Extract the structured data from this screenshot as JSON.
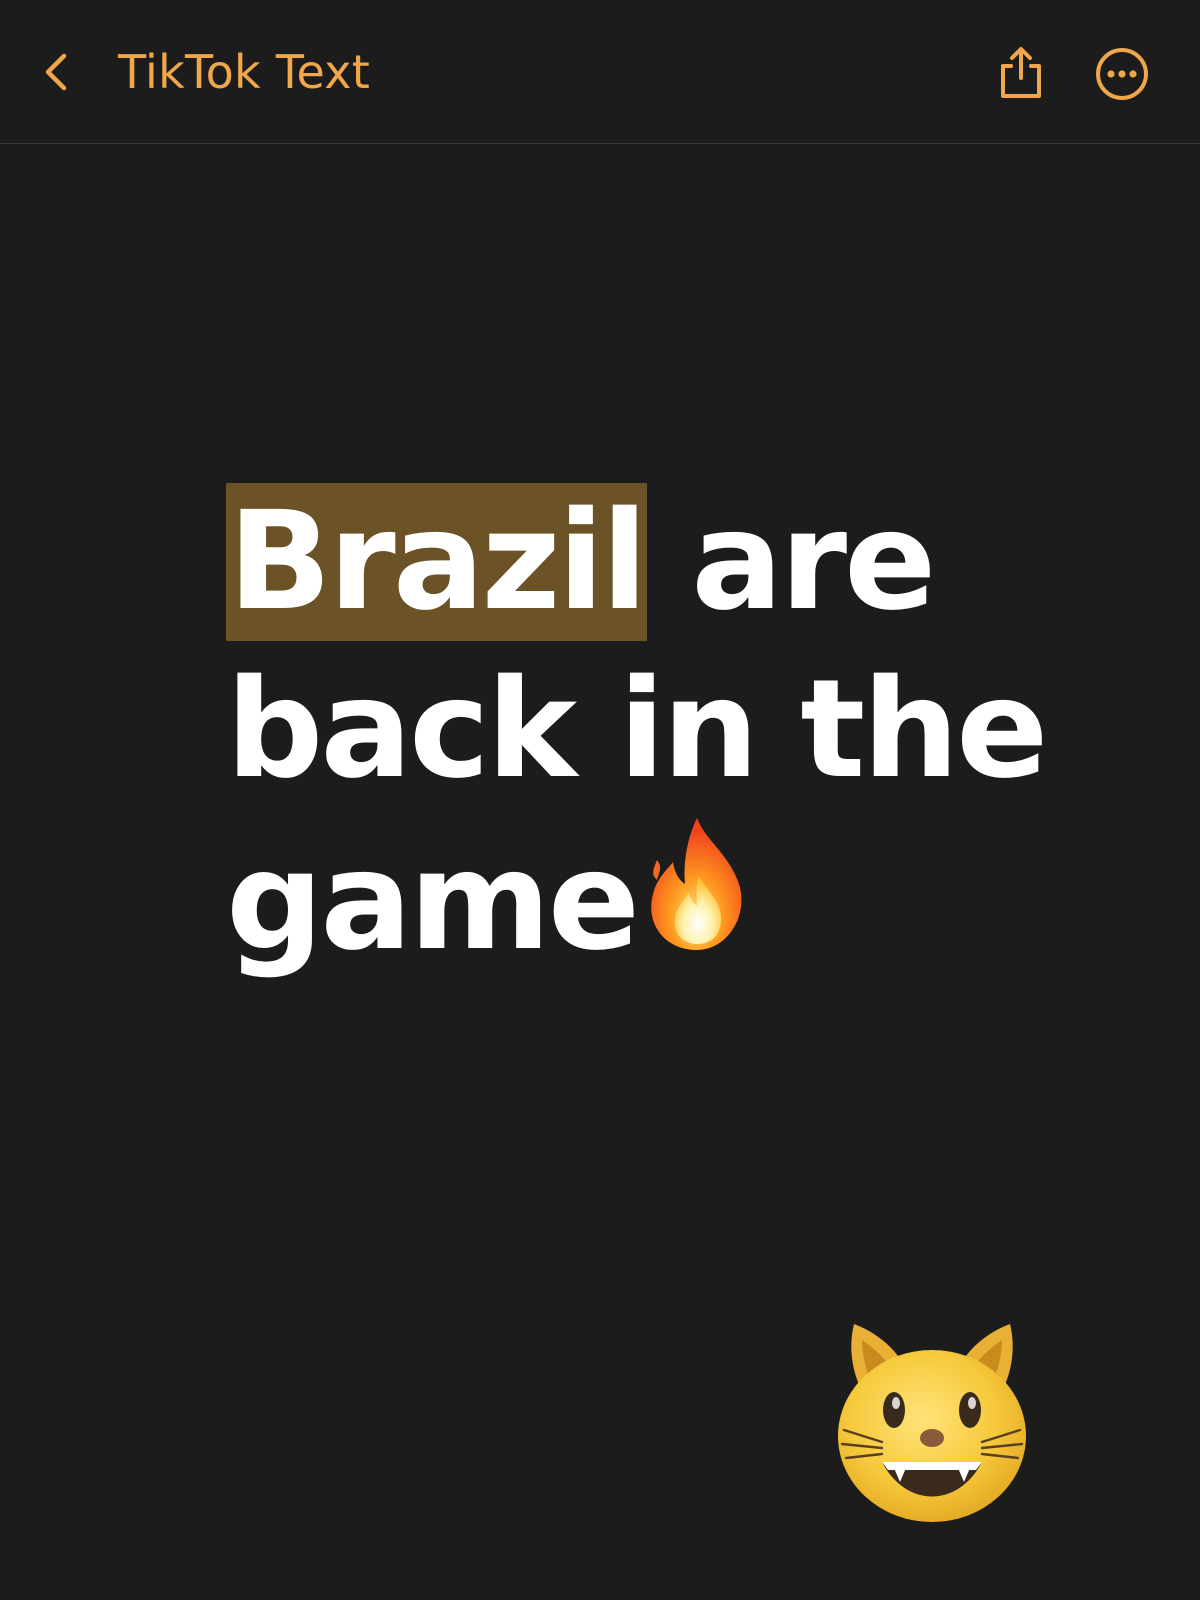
{
  "nav": {
    "back_icon": "chevron-left-icon",
    "title": "TikTok Text",
    "share_icon": "share-icon",
    "more_icon": "ellipsis-circle-icon",
    "accent_color": "#f0a64a"
  },
  "note": {
    "selected_word": "Brazil",
    "line1_rest": " are",
    "line2": "back in the",
    "line3": "game",
    "emoji_inline": "fire-emoji",
    "highlight_color": "#6b5327",
    "text_color": "#ffffff"
  },
  "sticker": {
    "emoji": "grinning-cat-emoji"
  },
  "background_color": "#1c1c1c"
}
